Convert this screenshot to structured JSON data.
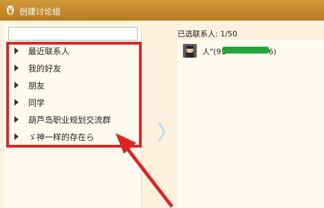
{
  "window": {
    "title": "创建讨论组",
    "title_icon": "qq-penguin-icon"
  },
  "search": {
    "value": "",
    "placeholder": ""
  },
  "groups": [
    {
      "label": "最近联系人"
    },
    {
      "label": "我的好友"
    },
    {
      "label": "朋友"
    },
    {
      "label": "同学"
    },
    {
      "label": "葫芦岛职业规划交流群"
    },
    {
      "label": "ゞ神一样的存在ら"
    }
  ],
  "selected": {
    "header": "已选联系人: 1/50",
    "contacts": [
      {
        "name": "人\"(91",
        "suffix": "6)"
      }
    ]
  },
  "colors": {
    "titlebar": "#c4892d",
    "annotation": "#e02424",
    "redaction": "#22a83a"
  }
}
